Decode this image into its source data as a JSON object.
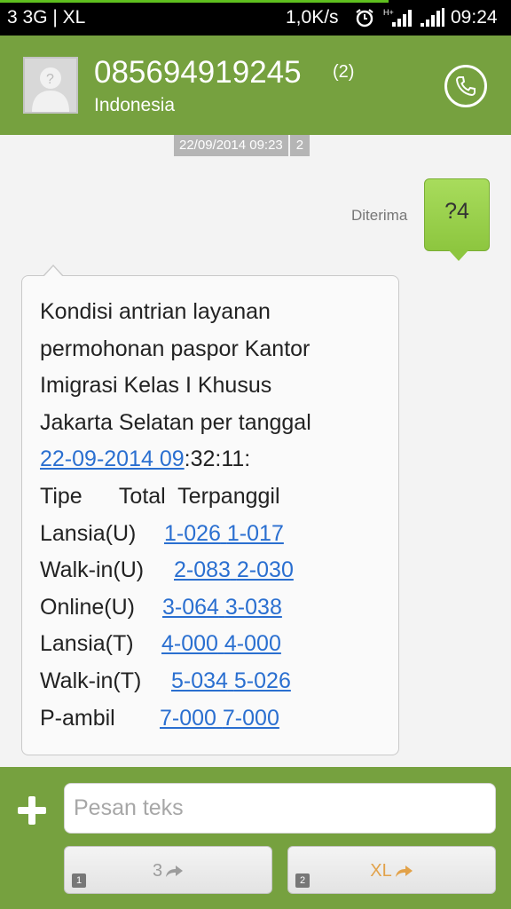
{
  "status_bar": {
    "left_text": "3 3G | XL",
    "speed": "1,0K/s",
    "net_type": "H+",
    "time": "09:24",
    "progress_percent": 76
  },
  "header": {
    "contact_number": "085694919245",
    "message_count": "(2)",
    "country": "Indonesia"
  },
  "conversation": {
    "date": "22/09/2014 09:23",
    "sim_badge": "2",
    "sent": {
      "status": "Diterima",
      "text": "?4"
    },
    "received": {
      "lines": [
        "Kondisi antrian layanan",
        "permohonan paspor Kantor",
        "Imigrasi Kelas I Khusus",
        "Jakarta Selatan per tanggal"
      ],
      "datetime_link": "22-09-2014 09",
      "datetime_rest": ":32:11:",
      "table_header": "Tipe      Total  Terpanggil",
      "rows": [
        {
          "type": "Lansia(U)",
          "total": "1-026",
          "called": "1-017"
        },
        {
          "type": "Walk-in(U)",
          "total": "2-083",
          "called": "2-030"
        },
        {
          "type": "Online(U)",
          "total": "3-064",
          "called": "3-038"
        },
        {
          "type": "Lansia(T)",
          "total": "4-000",
          "called": "4-000"
        },
        {
          "type": "Walk-in(T)",
          "total": "5-034",
          "called": "5-026"
        },
        {
          "type": "P-ambil",
          "total": "7-000",
          "called": "7-000"
        }
      ]
    }
  },
  "footer": {
    "input_placeholder": "Pesan teks",
    "sim1": {
      "label": "3",
      "num": "1"
    },
    "sim2": {
      "label": "XL",
      "num": "2"
    }
  },
  "colors": {
    "header_green": "#76a13f",
    "sent_bubble": "#8dc63f",
    "link_blue": "#2a6fd0",
    "sim2_orange": "#e2a24a"
  }
}
